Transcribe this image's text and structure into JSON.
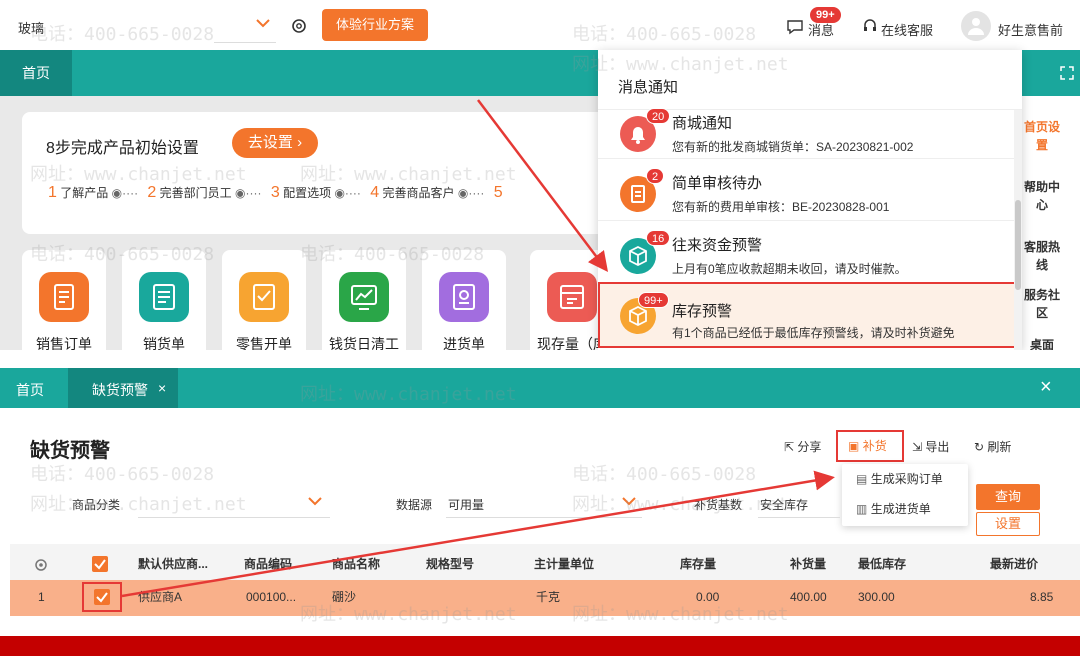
{
  "top": {
    "company_select": "玻璃",
    "trial_button": "体验行业方案",
    "messages_label": "消息",
    "messages_badge": "99+",
    "online_service": "在线客服",
    "user_name": "好生意售前",
    "home_tab": "首页",
    "setup_title": "8步完成产品初始设置",
    "setup_button": "去设置",
    "steps": [
      {
        "num": "1",
        "label": "了解产品"
      },
      {
        "num": "2",
        "label": "完善部门员工"
      },
      {
        "num": "3",
        "label": "配置选项"
      },
      {
        "num": "4",
        "label": "完善商品客户"
      },
      {
        "num": "5",
        "label": ""
      }
    ],
    "tiles": [
      {
        "label": "销售订单",
        "color": "#f3752c"
      },
      {
        "label": "销货单",
        "color": "#19a89c"
      },
      {
        "label": "零售开单",
        "color": "#f7a431"
      },
      {
        "label": "钱货日清工",
        "color": "#2aa648"
      },
      {
        "label": "进货单",
        "color": "#a26ddf"
      },
      {
        "label": "现存量（库",
        "color": "#ec5b54"
      }
    ],
    "side_panel": [
      "首页设置",
      "帮助中心",
      "客服热线",
      "服务社区",
      "桌面"
    ],
    "notifications": {
      "title": "消息通知",
      "items": [
        {
          "title": "商城通知",
          "desc": "您有新的批发商城销货单：SA-20230821-002",
          "badge": "20",
          "color": "#ec5b54"
        },
        {
          "title": "简单审核待办",
          "desc": "您有新的费用单审核：BE-20230828-001",
          "badge": "2",
          "color": "#f3752c"
        },
        {
          "title": "往来资金预警",
          "desc": "上月有0笔应收款超期未收回，请及时催款。",
          "badge": "16",
          "color": "#19a89c"
        },
        {
          "title": "库存预警",
          "desc": "有1个商品已经低于最低库存预警线，请及时补货避免",
          "badge": "99+",
          "color": "#f7a431"
        }
      ]
    }
  },
  "bottom": {
    "tabs": [
      "首页",
      "缺货预警"
    ],
    "tab_close": "×",
    "page_title": "缺货预警",
    "toolbar": {
      "share": "分享",
      "replenish": "补货",
      "export": "导出",
      "refresh": "刷新"
    },
    "replenish_menu": [
      "生成采购订单",
      "生成进货单"
    ],
    "filters": {
      "category_label": "商品分类",
      "source_label": "数据源",
      "source_value": "可用量",
      "basis_label": "补货基数",
      "basis_value": "安全库存"
    },
    "query_button": "查询",
    "settings_button": "设置",
    "columns": [
      "默认供应商...",
      "商品编码",
      "商品名称",
      "规格型号",
      "主计量单位",
      "库存量",
      "补货量",
      "最低库存",
      "最新进价"
    ],
    "rows": [
      {
        "index": "1",
        "supplier": "供应商A",
        "code": "000100...",
        "name": "硼沙",
        "spec": "",
        "unit": "千克",
        "stock": "0.00",
        "replenish": "400.00",
        "min_stock": "300.00",
        "latest_price": "8.85"
      }
    ]
  },
  "watermark": {
    "phone": "电话：400-665-0028",
    "url": "网址：www.chanjet.net"
  },
  "colors": {
    "teal": "#1aa79c",
    "orange": "#f3752c",
    "highlight": "#f9b08a",
    "red": "#e53935"
  }
}
